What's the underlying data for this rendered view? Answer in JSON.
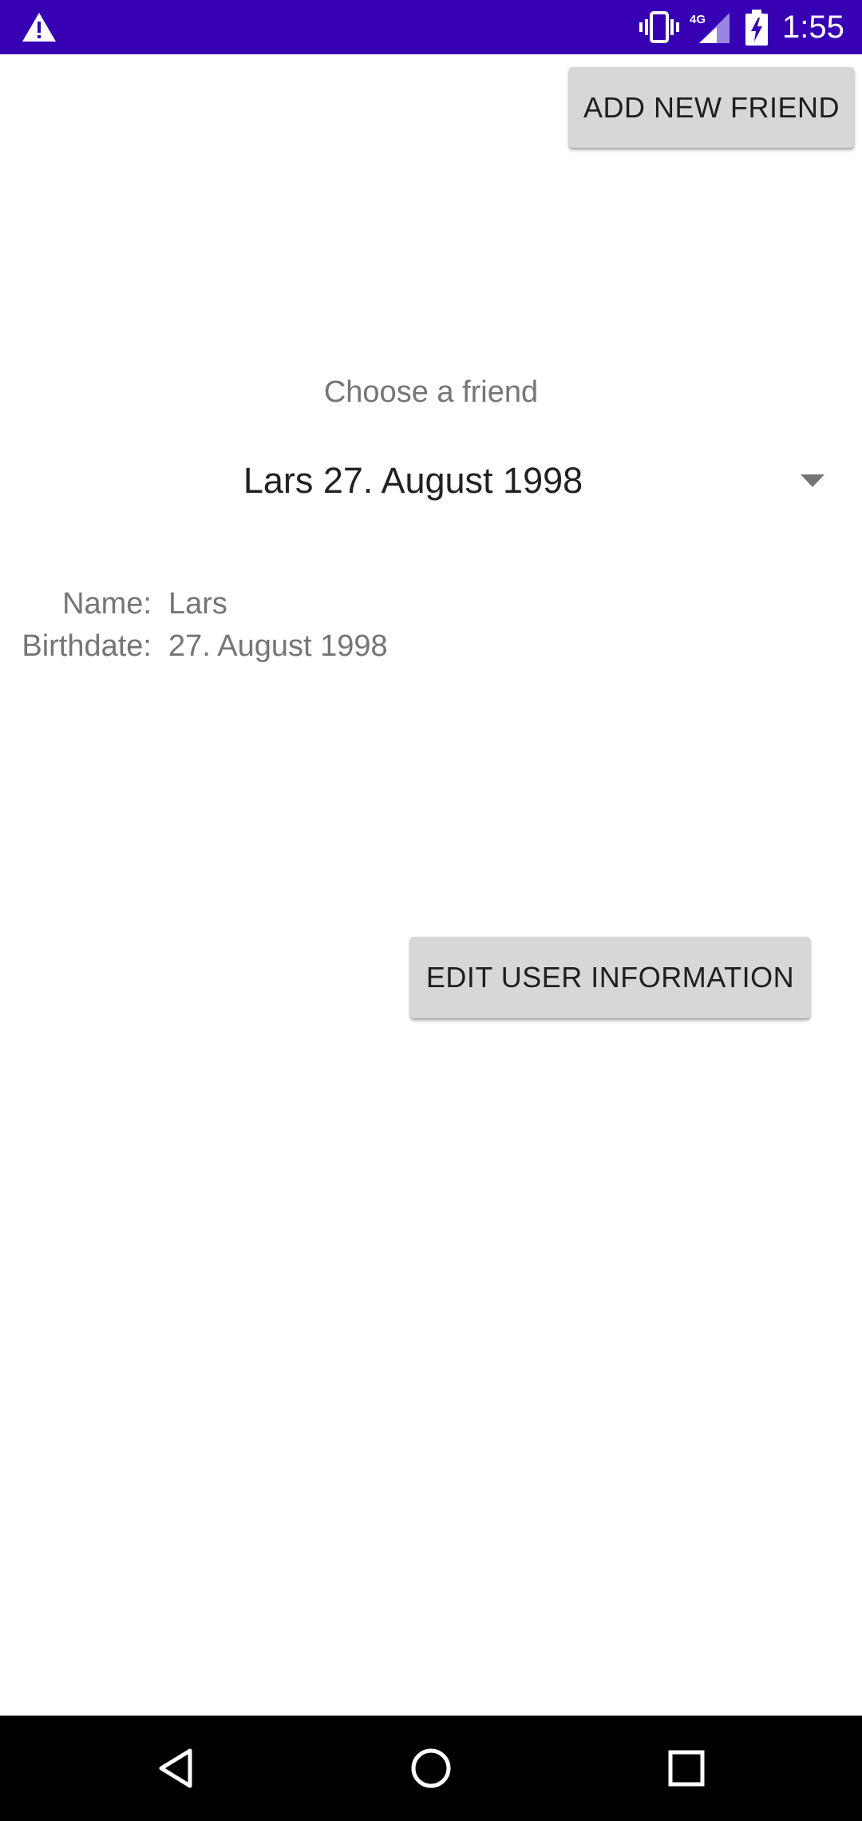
{
  "status_bar": {
    "time": "1:55",
    "network": "4G",
    "icons": [
      "warning-icon",
      "vibrate-icon",
      "signal-icon",
      "battery-charging-icon"
    ],
    "background_color": "#3700b3"
  },
  "toolbar": {
    "add_friend_label": "ADD NEW FRIEND"
  },
  "friend_picker": {
    "prompt": "Choose a friend",
    "selected": "Lars 27. August 1998"
  },
  "details": {
    "name_label": "Name:",
    "name_value": "Lars",
    "birthdate_label": "Birthdate:",
    "birthdate_value": "27. August 1998"
  },
  "actions": {
    "edit_label": "EDIT USER INFORMATION"
  },
  "nav_bar": {
    "icons": [
      "back-icon",
      "home-icon",
      "recents-icon"
    ]
  }
}
